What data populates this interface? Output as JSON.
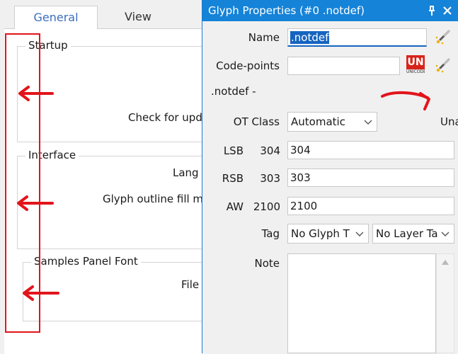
{
  "settings": {
    "tabs": [
      "General",
      "View"
    ],
    "groups": {
      "startup": "Startup",
      "interface": "Interface",
      "samples_font": "Samples Panel Font"
    },
    "cut_labels": {
      "check_updates": "Check for upd",
      "language": "Lang",
      "outline_fill": "Glyph outline fill m",
      "file": "File"
    }
  },
  "glyph_dialog": {
    "title": "Glyph Properties (#0 .notdef)",
    "name_label": "Name",
    "name_value": ".notdef",
    "codepoints_label": "Code-points",
    "codepoints_value": "",
    "unicode_badge_top": "UN",
    "unicode_badge_bottom": "UNICODE",
    "glyph_caption": ".notdef -",
    "ot_class_label": "OT Class",
    "ot_class_value": "Automatic",
    "cut_right_text": "Una",
    "lsb_label": "LSB",
    "lsb_readout": "304",
    "lsb_value": "304",
    "rsb_label": "RSB",
    "rsb_readout": "303",
    "rsb_value": "303",
    "aw_label": "AW",
    "aw_readout": "2100",
    "aw_value": "2100",
    "tag_label": "Tag",
    "glyph_tag_value": "No Glyph T",
    "layer_tag_value": "No Layer Ta",
    "note_label": "Note",
    "note_value": ""
  },
  "colors": {
    "title_bar": "#1583d8",
    "annotation_red": "#e2141b",
    "selection": "#1664c0",
    "active_tab_text": "#3b6ec0"
  }
}
